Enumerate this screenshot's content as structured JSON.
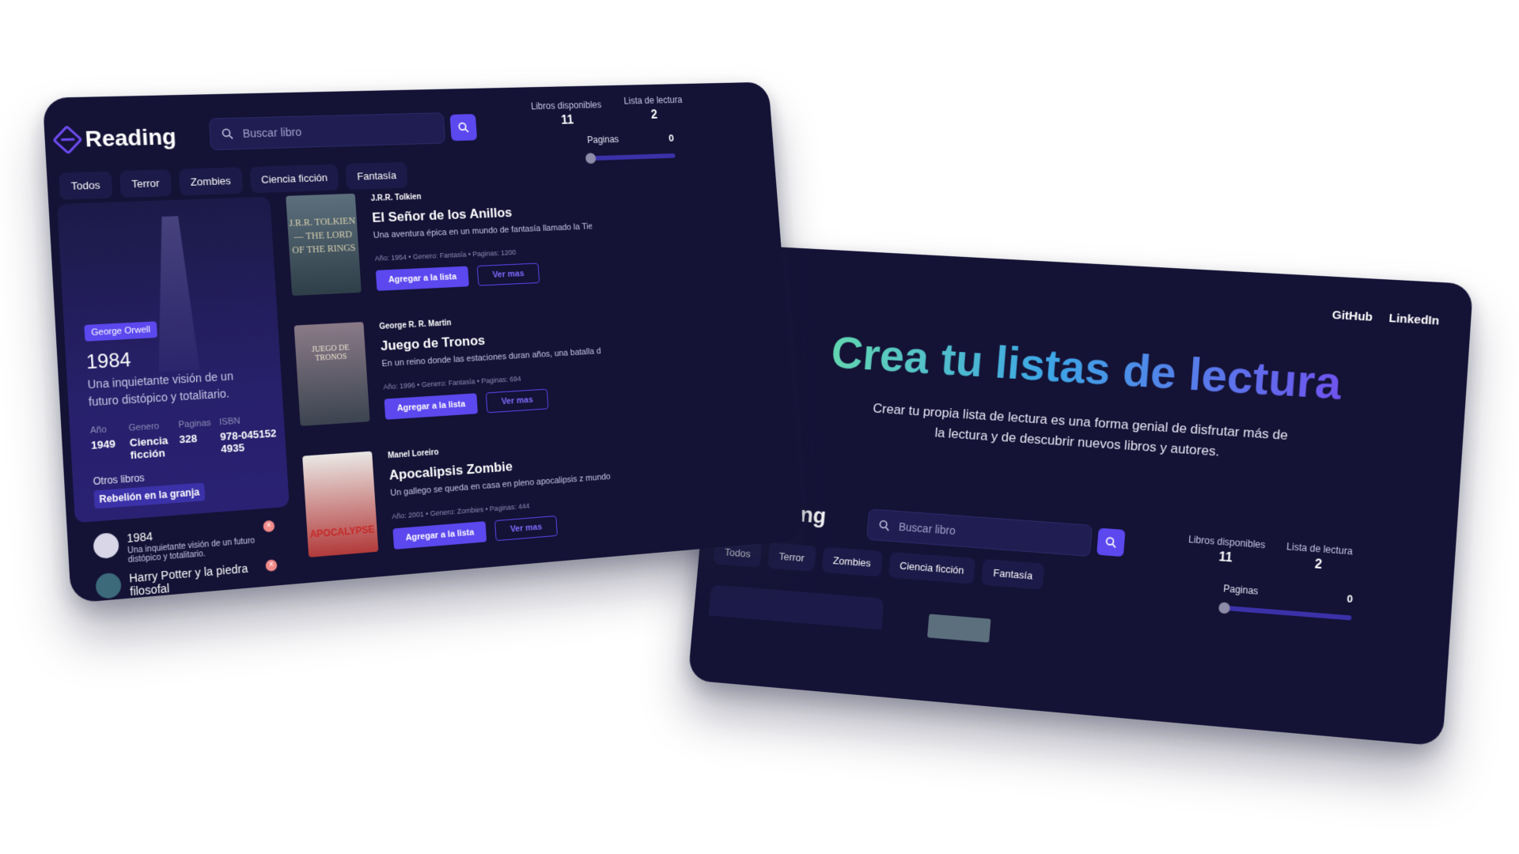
{
  "app": {
    "name": "Reading"
  },
  "search": {
    "placeholder": "Buscar libro"
  },
  "stats": {
    "available_label": "Libros disponibles",
    "available_value": "11",
    "reading_label": "Lista de lectura",
    "reading_value": "2"
  },
  "pages": {
    "label": "Paginas",
    "value": "0",
    "fraction": 0
  },
  "genres": [
    "Todos",
    "Terror",
    "Zombies",
    "Ciencia ficción",
    "Fantasía"
  ],
  "featured": {
    "badge": "George Orwell",
    "title": "1984",
    "description": "Una inquietante visión de un futuro distópico y totalitario.",
    "meta": [
      {
        "label": "Año",
        "value": "1949"
      },
      {
        "label": "Genero",
        "value": "Ciencia ficción"
      },
      {
        "label": "Paginas",
        "value": "328"
      },
      {
        "label": "ISBN",
        "value": "978-0451524935"
      }
    ],
    "others_label": "Otros libros",
    "others": [
      "Rebelión en la granja"
    ]
  },
  "reading_list": [
    {
      "title": "1984",
      "description": "Una inquietante visión de un futuro distópico y totalitario."
    },
    {
      "title": "Harry Potter y la piedra filosofal",
      "description": ""
    }
  ],
  "books": [
    {
      "author": "J.R.R. Tolkien",
      "title": "El Señor de los Anillos",
      "description": "Una aventura épica en un mundo de fantasía llamado la Tierra",
      "meta": "Año: 1954  •  Genero: Fantasía  •  Paginas: 1200",
      "cover_text": "J.R.R. TOLKIEN — THE LORD OF THE RINGS"
    },
    {
      "author": "George R. R. Martin",
      "title": "Juego de Tronos",
      "description": "En un reino donde las estaciones duran años, una batalla desarrolla.",
      "meta": "Año: 1996  •  Genero: Fantasía  •  Paginas: 694",
      "cover_text": "JUEGO DE TRONOS"
    },
    {
      "author": "Manel Loreiro",
      "title": "Apocalipsis Zombie",
      "description": "Un gallego se queda en casa en pleno apocalipsis z mundo",
      "meta": "Año: 2001  •  Genero: Zombies  •  Paginas: 444",
      "cover_text": "APOCALYPSE"
    }
  ],
  "buttons": {
    "add": "Agregar a la lista",
    "more": "Ver mas"
  },
  "nav": {
    "github": "GitHub",
    "linkedin": "LinkedIn"
  },
  "hero": {
    "title": "Crea tu listas de lectura",
    "subtitle": "Crear tu propia lista de lectura es una forma genial de disfrutar más de la lectura y de descubrir nuevos libros y autores."
  },
  "colors": {
    "background": "#141235",
    "accent": "#5b48ee",
    "remove": "#f28a8a"
  }
}
